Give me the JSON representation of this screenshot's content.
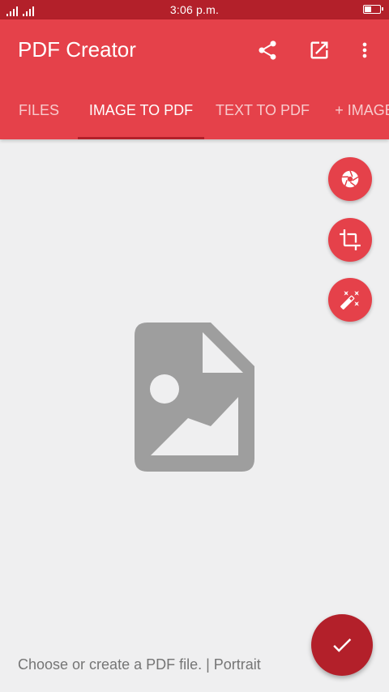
{
  "status_bar": {
    "time": "3:06 p.m."
  },
  "app_bar": {
    "title": "PDF Creator",
    "actions": [
      {
        "icon": "share-icon"
      },
      {
        "icon": "open-external-icon"
      },
      {
        "icon": "more-vert-icon"
      }
    ]
  },
  "tabs": [
    {
      "label": "FILES",
      "active": false
    },
    {
      "label": "IMAGE TO PDF",
      "active": true
    },
    {
      "label": "TEXT TO PDF",
      "active": false
    },
    {
      "label": "+ IMAGES",
      "active": false
    }
  ],
  "side_actions": [
    {
      "icon": "camera-shutter-icon"
    },
    {
      "icon": "crop-icon"
    },
    {
      "icon": "magic-wand-icon"
    }
  ],
  "placeholder": {
    "icon": "image-file-icon"
  },
  "footer": {
    "text": "Choose or create a PDF file. | Portrait"
  },
  "fab": {
    "icon": "check-icon"
  },
  "colors": {
    "status_bar": "#b3202a",
    "primary": "#e5414a",
    "accent_dark": "#b3202a",
    "background": "#efeff0",
    "placeholder_gray": "#9e9e9e",
    "footer_text": "#757575"
  }
}
